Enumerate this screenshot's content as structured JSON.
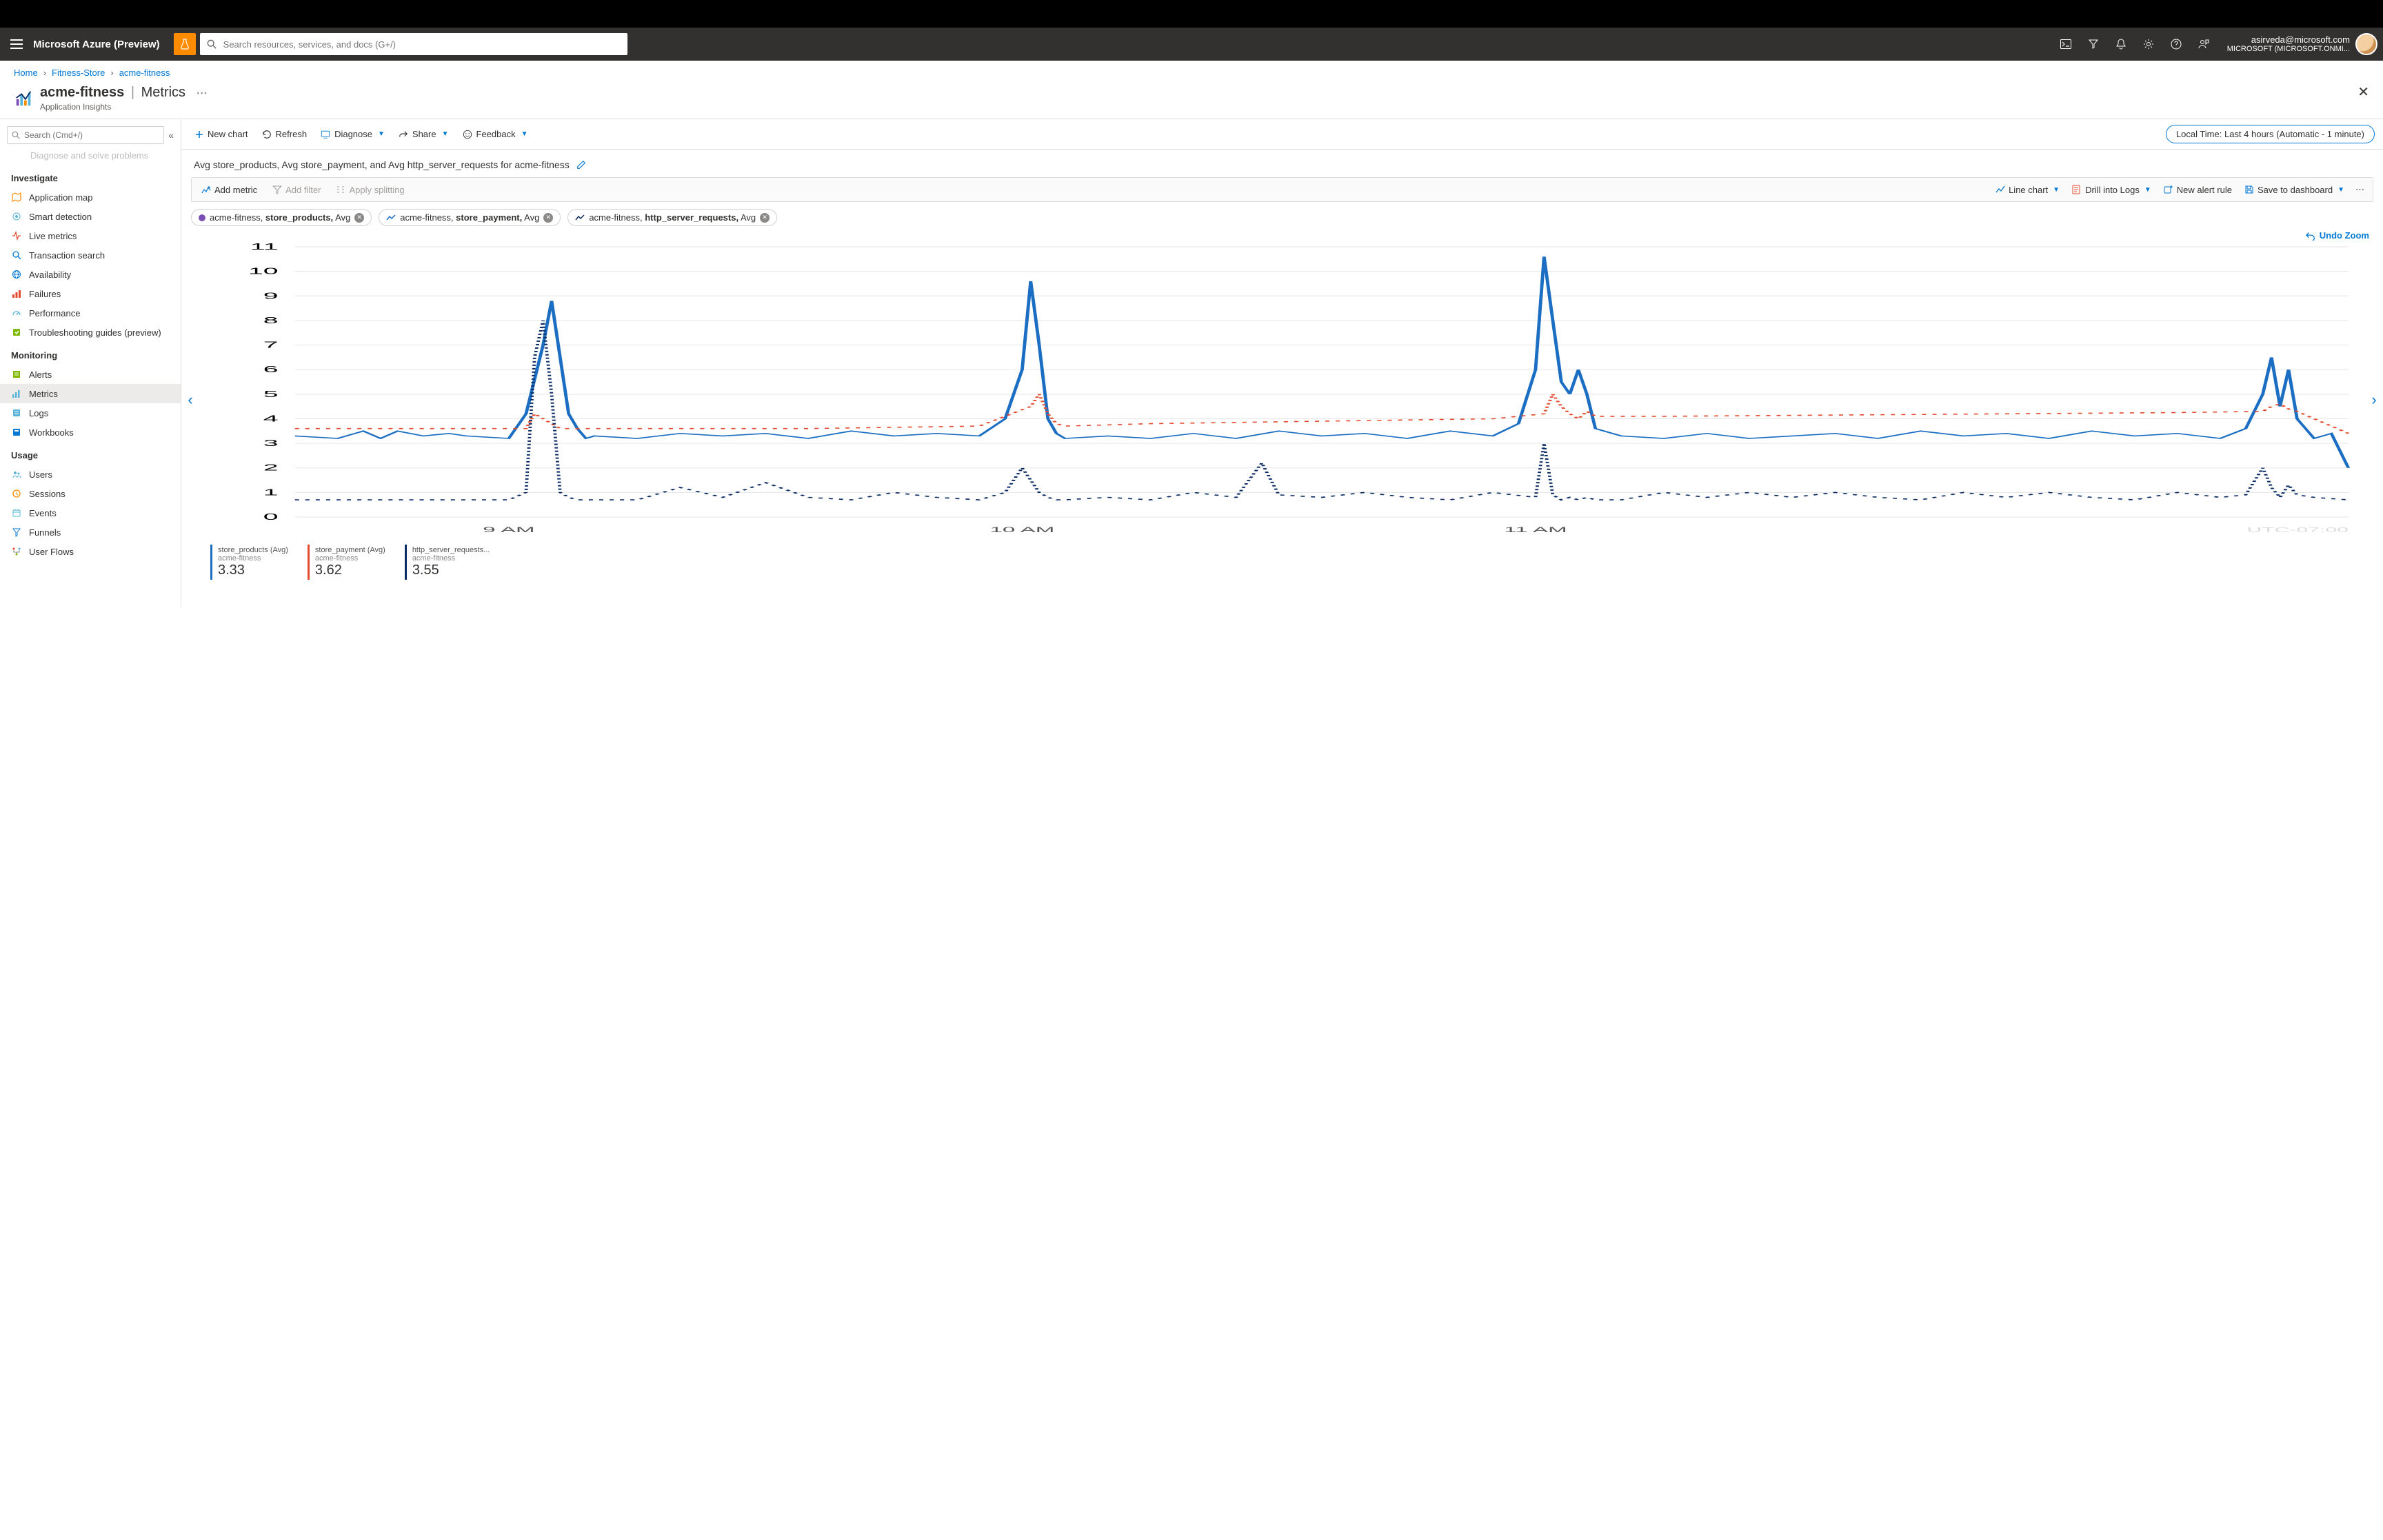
{
  "brand": "Microsoft Azure (Preview)",
  "search_placeholder": "Search resources, services, and docs (G+/)",
  "account": {
    "email": "asirveda@microsoft.com",
    "tenant": "MICROSOFT (MICROSOFT.ONMI..."
  },
  "breadcrumbs": [
    {
      "label": "Home",
      "link": true
    },
    {
      "label": "Fitness-Store",
      "link": true
    },
    {
      "label": "acme-fitness",
      "link": true
    }
  ],
  "blade": {
    "title": "acme-fitness",
    "section": "Metrics",
    "subtitle": "Application Insights",
    "side_search_placeholder": "Search (Cmd+/)",
    "side_ghost": "Diagnose and solve problems",
    "groups": [
      {
        "heading": "Investigate",
        "items": [
          {
            "label": "Application map",
            "name": "application-map",
            "icon": "map"
          },
          {
            "label": "Smart detection",
            "name": "smart-detection",
            "icon": "radar"
          },
          {
            "label": "Live metrics",
            "name": "live-metrics",
            "icon": "pulse"
          },
          {
            "label": "Transaction search",
            "name": "transaction-search",
            "icon": "search"
          },
          {
            "label": "Availability",
            "name": "availability",
            "icon": "globe"
          },
          {
            "label": "Failures",
            "name": "failures",
            "icon": "bars-red"
          },
          {
            "label": "Performance",
            "name": "performance",
            "icon": "gauge"
          },
          {
            "label": "Troubleshooting guides (preview)",
            "name": "troubleshooting",
            "icon": "guide"
          }
        ]
      },
      {
        "heading": "Monitoring",
        "items": [
          {
            "label": "Alerts",
            "name": "alerts",
            "icon": "alert"
          },
          {
            "label": "Metrics",
            "name": "metrics",
            "icon": "metrics",
            "active": true
          },
          {
            "label": "Logs",
            "name": "logs",
            "icon": "logs"
          },
          {
            "label": "Workbooks",
            "name": "workbooks",
            "icon": "workbook"
          }
        ]
      },
      {
        "heading": "Usage",
        "items": [
          {
            "label": "Users",
            "name": "users",
            "icon": "users"
          },
          {
            "label": "Sessions",
            "name": "sessions",
            "icon": "sessions"
          },
          {
            "label": "Events",
            "name": "events",
            "icon": "events"
          },
          {
            "label": "Funnels",
            "name": "funnels",
            "icon": "funnel"
          },
          {
            "label": "User Flows",
            "name": "user-flows",
            "icon": "flows"
          }
        ]
      }
    ]
  },
  "commands": {
    "new_chart": "New chart",
    "refresh": "Refresh",
    "diagnose": "Diagnose",
    "share": "Share",
    "feedback": "Feedback"
  },
  "time_range": "Local Time: Last 4 hours (Automatic - 1 minute)",
  "chart_title": "Avg store_products, Avg store_payment, and Avg http_server_requests for acme-fitness",
  "toolbar": {
    "add_metric": "Add metric",
    "add_filter": "Add filter",
    "apply_splitting": "Apply splitting",
    "line_chart": "Line chart",
    "drill_logs": "Drill into Logs",
    "new_alert": "New alert rule",
    "save_dash": "Save to dashboard"
  },
  "pills": [
    {
      "scope": "acme-fitness,",
      "metric": "store_products,",
      "agg": "Avg",
      "color": "#7b4fb5"
    },
    {
      "scope": "acme-fitness,",
      "metric": "store_payment,",
      "agg": "Avg",
      "color": "#1b6ec2",
      "style": "line"
    },
    {
      "scope": "acme-fitness,",
      "metric": "http_server_requests,",
      "agg": "Avg",
      "color": "#0b2c63",
      "style": "line"
    }
  ],
  "undo_zoom": "Undo Zoom",
  "legend": [
    {
      "title": "store_products (Avg)",
      "sub": "acme-fitness",
      "value": "3.33",
      "color": "blue"
    },
    {
      "title": "store_payment (Avg)",
      "sub": "acme-fitness",
      "value": "3.62",
      "color": "red"
    },
    {
      "title": "http_server_requests...",
      "sub": "acme-fitness",
      "value": "3.55",
      "color": "dark"
    }
  ],
  "utc_offset": "UTC-07:00",
  "chart_data": {
    "type": "line",
    "title": "Avg store_products, Avg store_payment, and Avg http_server_requests for acme-fitness",
    "x_unit": "minutes",
    "x_range_minutes": [
      0,
      240
    ],
    "x_tick_labels": [
      "9 AM",
      "10 AM",
      "11 AM"
    ],
    "x_tick_positions_min": [
      25,
      85,
      145
    ],
    "ylabel": "",
    "ylim": [
      0,
      11
    ],
    "series": [
      {
        "name": "store_products (Avg)",
        "color": "#1b6ec2",
        "style": "solid",
        "x": [
          0,
          5,
          8,
          10,
          12,
          15,
          18,
          20,
          25,
          27,
          29,
          30,
          31,
          32,
          33,
          34,
          35,
          40,
          45,
          50,
          55,
          60,
          65,
          70,
          75,
          80,
          83,
          85,
          86,
          87,
          88,
          89,
          90,
          95,
          100,
          105,
          110,
          115,
          120,
          125,
          130,
          135,
          140,
          143,
          145,
          146,
          147,
          148,
          149,
          150,
          151,
          152,
          155,
          160,
          165,
          170,
          175,
          180,
          185,
          190,
          195,
          200,
          205,
          210,
          215,
          220,
          225,
          228,
          230,
          231,
          232,
          233,
          234,
          236,
          238,
          240
        ],
        "y": [
          3.3,
          3.2,
          3.5,
          3.2,
          3.5,
          3.3,
          3.4,
          3.3,
          3.2,
          4.2,
          7.0,
          8.8,
          6.5,
          4.2,
          3.6,
          3.2,
          3.3,
          3.2,
          3.4,
          3.3,
          3.4,
          3.2,
          3.5,
          3.3,
          3.4,
          3.3,
          4.0,
          6.0,
          9.6,
          7.0,
          4.0,
          3.4,
          3.2,
          3.3,
          3.2,
          3.4,
          3.2,
          3.5,
          3.3,
          3.4,
          3.2,
          3.5,
          3.3,
          3.8,
          6.0,
          10.6,
          8.0,
          5.5,
          5.0,
          6.0,
          5.0,
          3.6,
          3.3,
          3.2,
          3.4,
          3.2,
          3.3,
          3.4,
          3.2,
          3.5,
          3.3,
          3.4,
          3.2,
          3.5,
          3.3,
          3.4,
          3.2,
          3.6,
          5.0,
          6.5,
          4.5,
          6.0,
          4.0,
          3.2,
          3.4,
          2.0
        ]
      },
      {
        "name": "store_payment (Avg)",
        "color": "#e34a2e",
        "style": "dotted",
        "x": [
          0,
          10,
          20,
          27,
          28,
          29,
          30,
          31,
          32,
          40,
          60,
          80,
          86,
          87,
          88,
          89,
          90,
          100,
          120,
          140,
          146,
          147,
          148,
          149,
          150,
          151,
          152,
          160,
          180,
          200,
          220,
          230,
          231,
          232,
          233,
          234,
          240
        ],
        "y": [
          3.6,
          3.6,
          3.6,
          3.6,
          4.2,
          4.0,
          3.8,
          3.6,
          3.6,
          3.6,
          3.6,
          3.7,
          4.5,
          5.0,
          4.2,
          3.8,
          3.7,
          3.8,
          3.9,
          4.0,
          4.2,
          5.0,
          4.5,
          4.2,
          4.0,
          4.3,
          4.1,
          4.1,
          4.15,
          4.2,
          4.25,
          4.3,
          4.5,
          4.6,
          4.4,
          4.3,
          3.4
        ]
      },
      {
        "name": "http_server_requests (Avg)",
        "color": "#0b2c63",
        "style": "dotted",
        "x": [
          0,
          5,
          10,
          15,
          20,
          25,
          27,
          28,
          29,
          30,
          31,
          32,
          33,
          34,
          35,
          40,
          45,
          50,
          55,
          60,
          65,
          70,
          75,
          80,
          83,
          85,
          86,
          87,
          88,
          89,
          90,
          95,
          100,
          105,
          110,
          113,
          115,
          120,
          125,
          130,
          135,
          140,
          145,
          146,
          147,
          148,
          149,
          150,
          151,
          152,
          155,
          160,
          165,
          170,
          175,
          180,
          185,
          190,
          195,
          200,
          205,
          210,
          215,
          220,
          225,
          228,
          230,
          231,
          232,
          233,
          234,
          236,
          240
        ],
        "y": [
          0.7,
          0.7,
          0.7,
          0.7,
          0.7,
          0.7,
          1.0,
          6.5,
          8.0,
          5.0,
          1.0,
          0.8,
          0.7,
          0.7,
          0.7,
          0.7,
          1.2,
          0.8,
          1.4,
          0.8,
          0.7,
          1.0,
          0.8,
          0.7,
          1.0,
          2.0,
          1.5,
          1.0,
          0.8,
          0.7,
          0.7,
          0.8,
          0.7,
          1.0,
          0.8,
          2.2,
          0.9,
          0.8,
          1.0,
          0.8,
          0.7,
          1.0,
          0.8,
          3.0,
          0.9,
          0.7,
          0.8,
          0.7,
          0.8,
          0.7,
          0.7,
          1.0,
          0.8,
          1.0,
          0.8,
          1.0,
          0.8,
          0.7,
          1.0,
          0.8,
          1.0,
          0.8,
          0.7,
          1.0,
          0.8,
          0.9,
          2.0,
          1.2,
          0.8,
          1.3,
          0.9,
          0.8,
          0.7
        ]
      }
    ]
  }
}
